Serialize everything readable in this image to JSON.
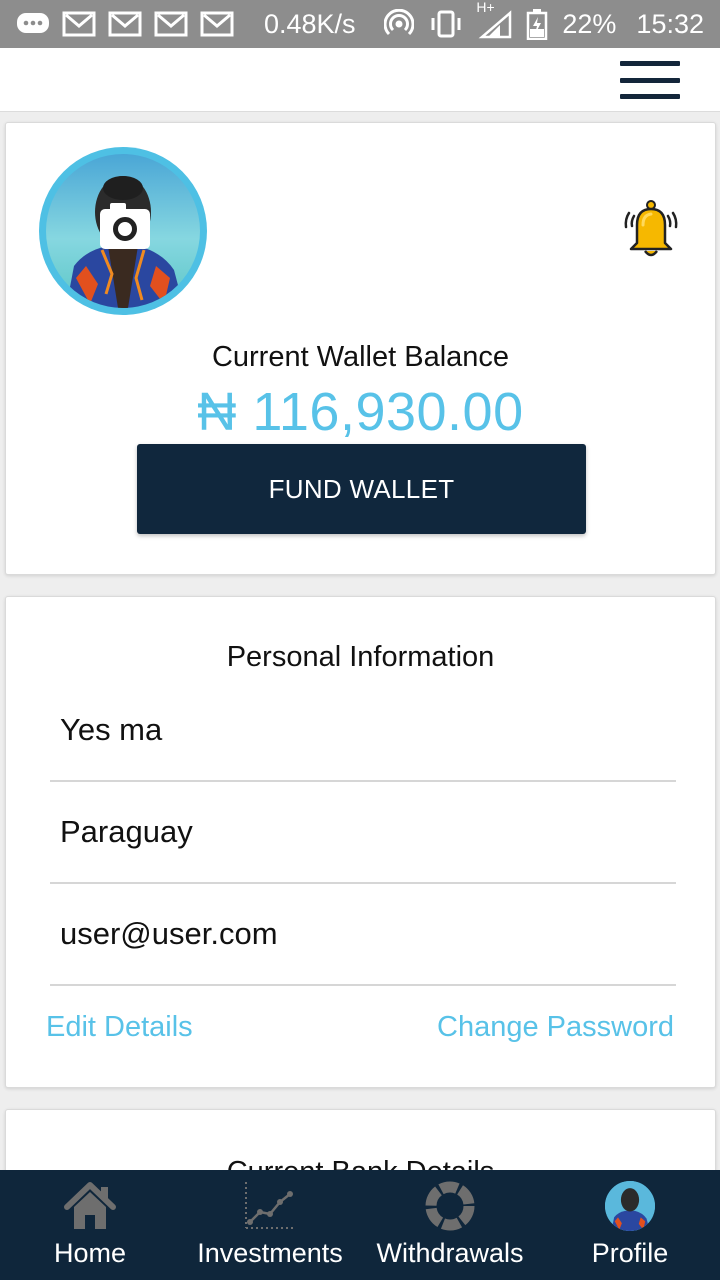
{
  "status_bar": {
    "speed": "0.48K/s",
    "network": "H+",
    "battery": "22%",
    "time": "15:32",
    "icons": [
      "chat-icon",
      "gmail-icon",
      "gmail-icon",
      "gmail-icon",
      "gmail-icon",
      "hotspot-icon",
      "vibrate-icon",
      "signal-icon",
      "battery-icon"
    ]
  },
  "header": {
    "menu_icon": "hamburger-menu-icon"
  },
  "wallet": {
    "label": "Current Wallet Balance",
    "amount": "₦ 116,930.00",
    "fund_button": "FUND WALLET",
    "notification_icon": "bell-icon",
    "avatar_icon": "camera-icon"
  },
  "personal": {
    "title": "Personal Information",
    "name": "Yes ma",
    "country": "Paraguay",
    "email": "user@user.com",
    "edit_link": "Edit Details",
    "password_link": "Change Password"
  },
  "bank": {
    "title": "Current Bank Details"
  },
  "nav": {
    "items": [
      {
        "label": "Home",
        "icon": "home-icon"
      },
      {
        "label": "Investments",
        "icon": "chart-icon"
      },
      {
        "label": "Withdrawals",
        "icon": "ring-icon"
      },
      {
        "label": "Profile",
        "icon": "avatar"
      }
    ]
  },
  "colors": {
    "accent": "#58c2e8",
    "navy": "#10273d",
    "bell": "#f6b800"
  }
}
